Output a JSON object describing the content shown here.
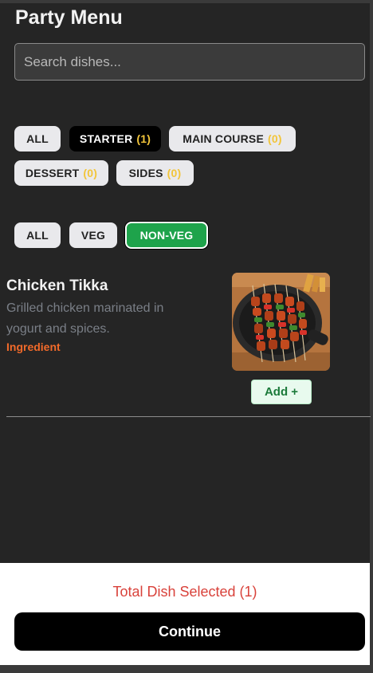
{
  "header": {
    "title": "Party Menu"
  },
  "search": {
    "placeholder": "Search dishes..."
  },
  "categories": [
    {
      "label": "ALL",
      "count": null,
      "active": false
    },
    {
      "label": "STARTER",
      "count": "(1)",
      "active": true
    },
    {
      "label": "MAIN COURSE",
      "count": "(0)",
      "active": false
    },
    {
      "label": "DESSERT",
      "count": "(0)",
      "active": false
    },
    {
      "label": "SIDES",
      "count": "(0)",
      "active": false
    }
  ],
  "diet_filters": [
    {
      "label": "ALL",
      "active": false
    },
    {
      "label": "VEG",
      "active": false
    },
    {
      "label": "NON-VEG",
      "active": true
    }
  ],
  "dishes": [
    {
      "name": "Chicken Tikka",
      "description": "Grilled chicken marinated in yogurt and spices.",
      "tag": "Ingredient",
      "image_icon": "chicken-tikka-skewers-photo",
      "add_label": "Add +"
    }
  ],
  "footer": {
    "total_text": "Total Dish Selected (1)",
    "continue_label": "Continue"
  },
  "colors": {
    "background": "#252525",
    "count_accent": "#f2c53a",
    "non_veg_active": "#1ea34b",
    "tag": "#f26a2a",
    "total_text": "#d9423b",
    "add_button_bg": "#e8faee"
  }
}
